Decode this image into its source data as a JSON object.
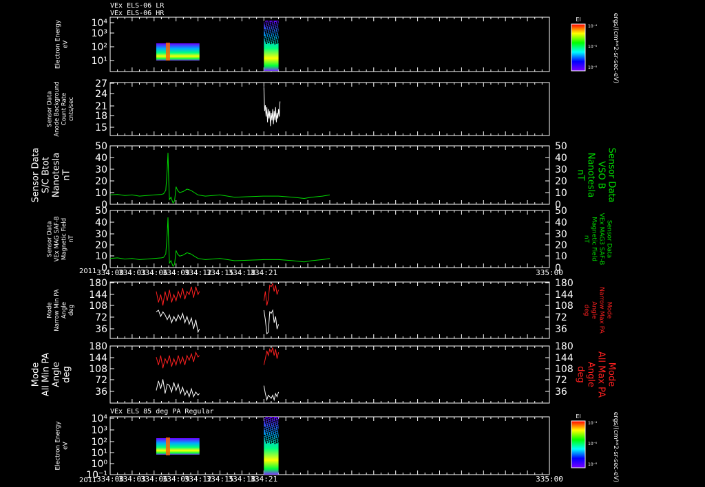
{
  "headers": {
    "top_line1": "VEx ELS-06 LR",
    "top_line2": "VEx ELS-06 HR",
    "bottom": "VEx ELS 85 deg PA Regular"
  },
  "colorbar": {
    "title": "El",
    "units": "ergs/(cm**2-sr-sec-eV)",
    "tick_labels": [
      "10⁻⁴",
      "10⁻⁶",
      "10⁻⁸"
    ],
    "stops": [
      "#7a00ff",
      "#0000ff",
      "#00ffff",
      "#00ff00",
      "#ffff00",
      "#ff0000"
    ]
  },
  "colors": {
    "green": "#00dd00",
    "red": "#ff2020",
    "white": "#ffffff"
  },
  "chart_data": [
    {
      "type": "heatmap",
      "ylabel": [
        "Electron Energy",
        "eV"
      ],
      "ytick_labels": [
        "10⁴",
        "10³",
        "10²",
        "10¹"
      ],
      "xrange": [
        0,
        60
      ],
      "data_spans": [
        [
          6.3,
          12.2
        ],
        [
          21.0,
          23.0
        ]
      ]
    },
    {
      "type": "line",
      "ylabel": [
        "Sensor Data",
        "Anode Background",
        "Count Rate",
        "cnts/sec"
      ],
      "ytick_labels": [
        "27",
        "24",
        "21",
        "18",
        "15"
      ],
      "ylim": [
        13,
        27
      ],
      "series": [
        {
          "color": "#ffffff",
          "x": [
            21.0,
            21.1,
            21.2,
            21.3,
            21.4,
            21.5,
            21.6,
            21.7,
            21.8,
            21.9,
            22.0,
            22.1,
            22.2,
            22.3,
            22.4,
            22.5,
            22.6,
            22.7,
            22.8,
            22.9,
            23.0,
            23.1,
            23.2
          ],
          "y": [
            25.8,
            19.5,
            21.0,
            18.0,
            20.5,
            16.5,
            20.0,
            17.5,
            19.5,
            15.5,
            19.0,
            17.0,
            20.0,
            16.0,
            19.5,
            17.0,
            20.5,
            16.5,
            19.0,
            17.5,
            20.0,
            18.0,
            22.0
          ]
        }
      ]
    },
    {
      "type": "line",
      "ylabel": [
        "Sensor Data",
        "S/C Btot",
        "Nanotesla",
        "nT"
      ],
      "ylabel_right": [
        "Sensor Data",
        "VSO B",
        "Nanotesla",
        "nT"
      ],
      "ytick_labels": [
        "50",
        "40",
        "30",
        "20",
        "10",
        "0"
      ],
      "ylim": [
        0,
        50
      ],
      "series": [
        {
          "color": "#00dd00",
          "x": [
            0,
            1,
            2,
            3,
            4,
            5,
            6,
            7,
            7.3,
            7.6,
            7.8,
            7.9,
            8.0,
            8.1,
            8.3,
            8.6,
            8.8,
            9.0,
            9.2,
            9.5,
            10.0,
            10.5,
            11.0,
            11.5,
            12.0,
            13,
            15,
            17,
            19,
            21,
            23,
            25,
            26.5,
            27.5,
            29,
            30
          ],
          "y": [
            8,
            8.5,
            7.5,
            8,
            7,
            7.5,
            8,
            8.5,
            9,
            12,
            30,
            44,
            20,
            4,
            6,
            1,
            3,
            15,
            12,
            10,
            11,
            13,
            12,
            10,
            8,
            7,
            8,
            6,
            6.5,
            7,
            7,
            6,
            5,
            6,
            7,
            8
          ]
        }
      ]
    },
    {
      "type": "line",
      "ylabel": [
        "Sensor Data",
        "VEx MAG SAF-B",
        "Magnetic Field",
        "nT"
      ],
      "ylabel_right": [
        "Sensor Data",
        "VEx MAG3 SAF-B",
        "Magnetic Field",
        "nT"
      ],
      "ytick_labels": [
        "50",
        "40",
        "30",
        "20",
        "10",
        "0"
      ],
      "ylim": [
        0,
        50
      ],
      "series": [
        {
          "color": "#00dd00",
          "x": [
            0,
            1,
            2,
            3,
            4,
            5,
            6,
            7,
            7.3,
            7.6,
            7.8,
            7.9,
            8.0,
            8.1,
            8.3,
            8.6,
            8.8,
            9.0,
            9.2,
            9.5,
            10.0,
            10.5,
            11.0,
            11.5,
            12.0,
            13,
            15,
            17,
            19,
            21,
            23,
            25,
            26.5,
            27.5,
            29,
            30
          ],
          "y": [
            8,
            8.5,
            7.5,
            8,
            7,
            7.5,
            8,
            8.5,
            9,
            12,
            30,
            44,
            20,
            4,
            6,
            1,
            3,
            15,
            12,
            10,
            11,
            13,
            12,
            10,
            8,
            7,
            8,
            6,
            6.5,
            7,
            7,
            6,
            5,
            6,
            7,
            8
          ]
        }
      ]
    },
    {
      "type": "line",
      "ylabel": [
        "Mode",
        "Narrow Min PA",
        "Angle",
        "deg"
      ],
      "ylabel_right": [
        "Mode",
        "Narrow Max PA",
        "Angle",
        "deg"
      ],
      "ytick_labels": [
        "180",
        "144",
        "108",
        "72",
        "36"
      ],
      "ylim": [
        0,
        180
      ],
      "series": [
        {
          "color": "#ff2020",
          "x": [
            6.3,
            6.6,
            6.9,
            7.2,
            7.5,
            7.8,
            8.1,
            8.4,
            8.7,
            9.0,
            9.3,
            9.6,
            9.9,
            10.2,
            10.5,
            10.8,
            11.1,
            11.4,
            11.7,
            12.0,
            12.2,
            21.0,
            21.2,
            21.4,
            21.6,
            21.8,
            22.0,
            22.2,
            22.4,
            22.6,
            22.8,
            23.0
          ],
          "y": [
            150,
            115,
            140,
            105,
            150,
            120,
            155,
            115,
            140,
            120,
            150,
            130,
            160,
            125,
            150,
            140,
            165,
            130,
            165,
            140,
            150,
            120,
            150,
            105,
            125,
            170,
            165,
            175,
            150,
            170,
            140,
            155
          ]
        },
        {
          "color": "#ffffff",
          "x": [
            6.3,
            6.6,
            6.9,
            7.2,
            7.5,
            7.8,
            8.1,
            8.4,
            8.7,
            9.0,
            9.3,
            9.6,
            9.9,
            10.2,
            10.5,
            10.8,
            11.1,
            11.4,
            11.7,
            12.0,
            12.2,
            21.0,
            21.2,
            21.4,
            21.6,
            21.8,
            22.0,
            22.2,
            22.4,
            22.6,
            22.8,
            23.0
          ],
          "y": [
            85,
            90,
            70,
            85,
            75,
            60,
            75,
            50,
            70,
            55,
            75,
            60,
            80,
            50,
            70,
            45,
            65,
            30,
            60,
            20,
            30,
            90,
            60,
            15,
            20,
            85,
            80,
            90,
            50,
            70,
            30,
            45
          ]
        }
      ]
    },
    {
      "type": "line",
      "ylabel": [
        "Mode",
        "All Min PA",
        "Angle",
        "deg"
      ],
      "ylabel_right": [
        "Mode",
        "All Max PA",
        "Angle",
        "deg"
      ],
      "ytick_labels": [
        "180",
        "144",
        "108",
        "72",
        "36"
      ],
      "ylim": [
        0,
        180
      ],
      "series": [
        {
          "color": "#ff2020",
          "x": [
            6.3,
            6.6,
            6.9,
            7.2,
            7.5,
            7.8,
            8.1,
            8.4,
            8.7,
            9.0,
            9.3,
            9.6,
            9.9,
            10.2,
            10.5,
            10.8,
            11.1,
            11.4,
            11.7,
            12.0,
            12.2,
            21.0,
            21.2,
            21.4,
            21.6,
            21.8,
            22.0,
            22.2,
            22.4,
            22.6,
            22.8,
            23.0
          ],
          "y": [
            145,
            120,
            150,
            110,
            140,
            125,
            150,
            115,
            140,
            120,
            150,
            125,
            145,
            120,
            150,
            135,
            155,
            130,
            160,
            145,
            150,
            120,
            140,
            165,
            150,
            170,
            160,
            175,
            150,
            170,
            140,
            160
          ]
        },
        {
          "color": "#ffffff",
          "x": [
            6.3,
            6.6,
            6.9,
            7.2,
            7.5,
            7.8,
            8.1,
            8.4,
            8.7,
            9.0,
            9.3,
            9.6,
            9.9,
            10.2,
            10.5,
            10.8,
            11.1,
            11.4,
            11.7,
            12.0,
            12.2,
            21.0,
            21.2,
            21.4,
            21.6,
            21.8,
            22.0,
            22.2,
            22.4,
            22.6,
            22.8,
            23.0
          ],
          "y": [
            40,
            70,
            45,
            75,
            30,
            60,
            55,
            35,
            65,
            40,
            60,
            30,
            50,
            25,
            40,
            20,
            45,
            20,
            35,
            25,
            30,
            55,
            30,
            10,
            25,
            20,
            15,
            25,
            10,
            30,
            20,
            35
          ]
        }
      ]
    },
    {
      "type": "heatmap",
      "ylabel": [
        "Electron Energy",
        "eV"
      ],
      "ytick_labels": [
        "10⁴",
        "10³",
        "10²",
        "10¹",
        "10⁰",
        "10⁻¹"
      ],
      "xrange": [
        0,
        60
      ],
      "data_spans": [
        [
          6.3,
          12.2
        ],
        [
          21.0,
          23.0
        ]
      ]
    }
  ],
  "time_axis": {
    "year": "2011",
    "labels": [
      "334:00",
      "334:03",
      "334:06",
      "334:09",
      "334:12",
      "334:15",
      "334:18",
      "334:21",
      "335:00"
    ]
  }
}
